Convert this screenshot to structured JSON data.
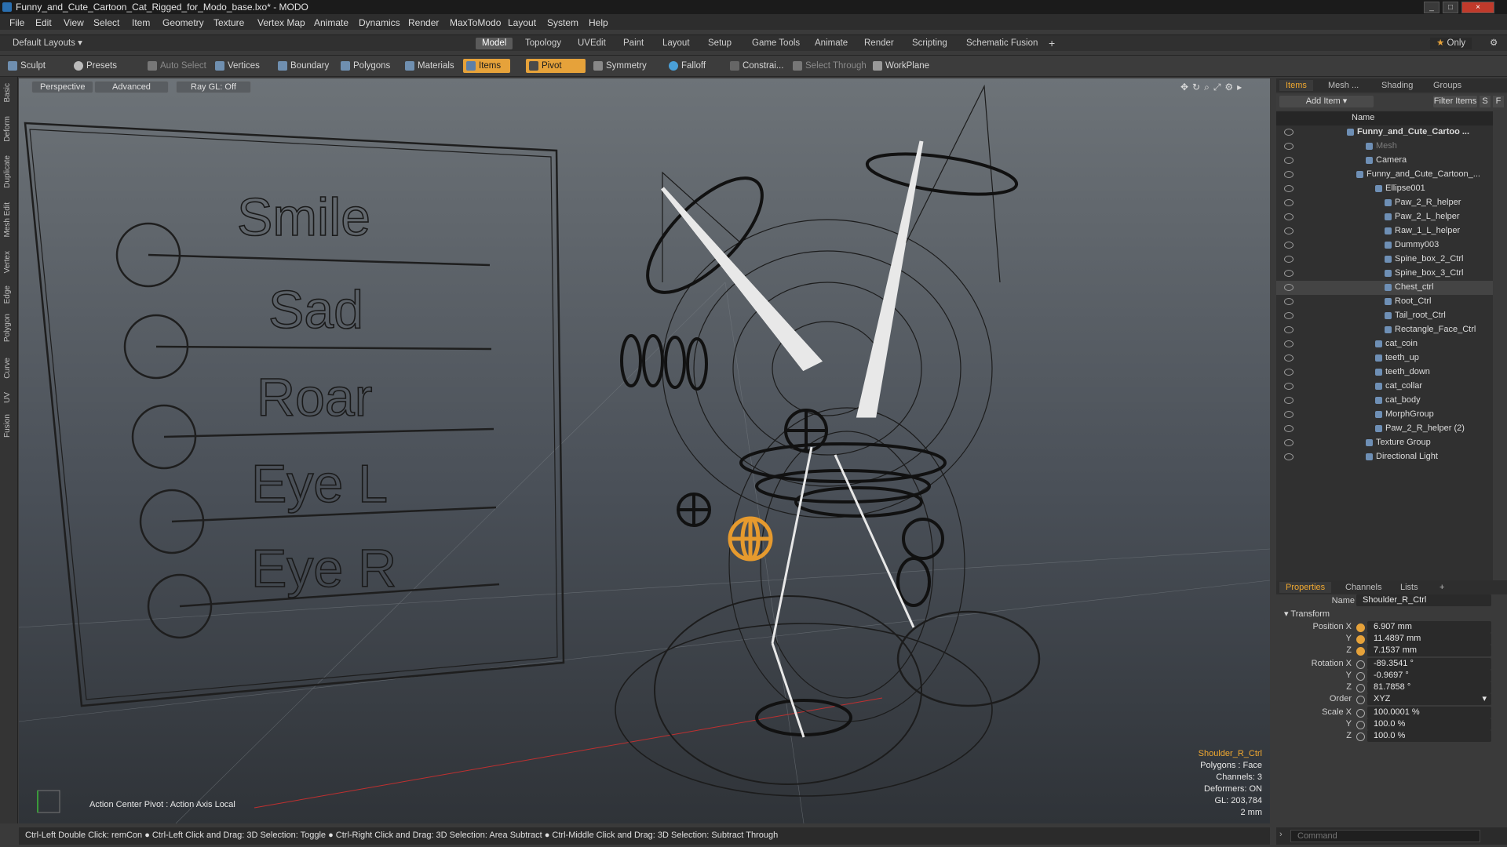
{
  "window": {
    "title": "Funny_and_Cute_Cartoon_Cat_Rigged_for_Modo_base.lxo* - MODO",
    "controls": [
      "_",
      "□",
      "×"
    ]
  },
  "menu": [
    "File",
    "Edit",
    "View",
    "Select",
    "Item",
    "Geometry",
    "Texture",
    "Vertex Map",
    "Animate",
    "Dynamics",
    "Render",
    "MaxToModo",
    "Layout",
    "System",
    "Help"
  ],
  "layouts": {
    "current": "Default Layouts",
    "tabs": [
      "Model",
      "Topology",
      "UVEdit",
      "Paint",
      "Layout",
      "Setup",
      "Game Tools",
      "Animate",
      "Render",
      "Scripting",
      "Schematic Fusion"
    ],
    "active": "Model",
    "add": "+",
    "only_label": "Only"
  },
  "toolbar": {
    "sculpt": "Sculpt",
    "presets": "Presets",
    "auto_select": "Auto Select",
    "vertices": "Vertices",
    "boundary": "Boundary",
    "polygons": "Polygons",
    "materials": "Materials",
    "items": "Items",
    "pivot": "Pivot",
    "symmetry": "Symmetry",
    "falloff": "Falloff",
    "constraints": "Constrai...",
    "select_through": "Select Through",
    "workplane": "WorkPlane"
  },
  "left_tabs": [
    "Basic",
    "Deform",
    "Duplicate",
    "Mesh Edit",
    "Vertex",
    "Edge",
    "Polygon",
    "Curve",
    "UV",
    "Fusion"
  ],
  "viewport": {
    "view": "Perspective",
    "mode": "Advanced",
    "raygl": "Ray GL: Off",
    "board_labels": [
      "Smile",
      "Sad",
      "Roar",
      "Eye L",
      "Eye R"
    ],
    "action_center": "Action Center Pivot : Action Axis Local",
    "info": {
      "selected": "Shoulder_R_Ctrl",
      "polygons": "Polygons : Face",
      "channels": "Channels: 3",
      "deformers": "Deformers: ON",
      "gl": "GL: 203,784",
      "unit": "2 mm"
    }
  },
  "items_panel": {
    "tabs": [
      "Items",
      "Mesh ...",
      "Shading",
      "Groups"
    ],
    "add_item": "Add Item",
    "filter": "Filter Items",
    "btn_s": "S",
    "btn_f": "F",
    "column": "Name",
    "rows": [
      {
        "label": "Funny_and_Cute_Cartoo ...",
        "indent": 0
      },
      {
        "label": "Mesh",
        "indent": 2
      },
      {
        "label": "Camera",
        "indent": 2
      },
      {
        "label": "Funny_and_Cute_Cartoon_...",
        "indent": 1
      },
      {
        "label": "Ellipse001",
        "indent": 3
      },
      {
        "label": "Paw_2_R_helper",
        "indent": 4
      },
      {
        "label": "Paw_2_L_helper",
        "indent": 4
      },
      {
        "label": "Raw_1_L_helper",
        "indent": 4
      },
      {
        "label": "Dummy003",
        "indent": 4
      },
      {
        "label": "Spine_box_2_Ctrl",
        "indent": 4
      },
      {
        "label": "Spine_box_3_Ctrl",
        "indent": 4
      },
      {
        "label": "Chest_ctrl",
        "indent": 4
      },
      {
        "label": "Root_Ctrl",
        "indent": 4
      },
      {
        "label": "Tail_root_Ctrl",
        "indent": 4
      },
      {
        "label": "Rectangle_Face_Ctrl",
        "indent": 4
      },
      {
        "label": "cat_coin",
        "indent": 3
      },
      {
        "label": "teeth_up",
        "indent": 3
      },
      {
        "label": "teeth_down",
        "indent": 3
      },
      {
        "label": "cat_collar",
        "indent": 3
      },
      {
        "label": "cat_body",
        "indent": 3
      },
      {
        "label": "MorphGroup",
        "indent": 3
      },
      {
        "label": "Paw_2_R_helper (2)",
        "indent": 3
      },
      {
        "label": "Texture Group",
        "indent": 2
      },
      {
        "label": "Directional Light",
        "indent": 2
      }
    ]
  },
  "properties": {
    "tabs": [
      "Properties",
      "Channels",
      "Lists",
      "+"
    ],
    "name_label": "Name",
    "name_value": "Shoulder_R_Ctrl",
    "section": "Transform",
    "position_label": "Position X",
    "rotation_label": "Rotation X",
    "scale_label": "Scale X",
    "order_label": "Order",
    "y_label": "Y",
    "z_label": "Z",
    "position": [
      "6.907 mm",
      "11.4897 mm",
      "7.1537 mm"
    ],
    "rotation": [
      "-89.3541 °",
      "-0.9697 °",
      "81.7858 °"
    ],
    "order": "XYZ",
    "scale": [
      "100.0001 %",
      "100.0 %",
      "100.0 %"
    ]
  },
  "status": "Ctrl-Left Double Click: remCon ● Ctrl-Left Click and Drag: 3D Selection: Toggle ● Ctrl-Right Click and Drag: 3D Selection: Area Subtract ● Ctrl-Middle Click and Drag: 3D Selection: Subtract Through",
  "command_placeholder": "Command",
  "colors": {
    "accent": "#e6a23a",
    "viewport_top": "#6d7378",
    "viewport_bottom": "#2f3338"
  }
}
